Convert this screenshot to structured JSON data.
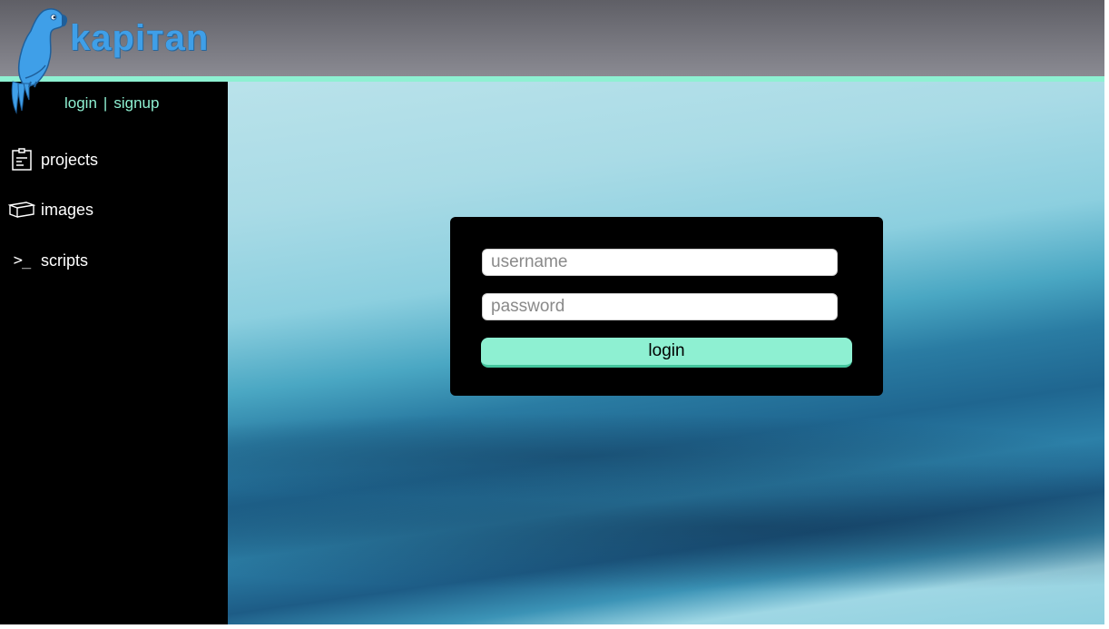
{
  "app": {
    "brand": "kapiтan",
    "logo_icon": "parrot-icon",
    "accent_color": "#8ef0d2",
    "brand_color": "#3f9fe8"
  },
  "sidebar": {
    "auth": {
      "login": "login",
      "separator": "|",
      "signup": "signup"
    },
    "items": [
      {
        "label": "projects",
        "icon": "clipboard-icon"
      },
      {
        "label": "images",
        "icon": "box-icon"
      },
      {
        "label": "scripts",
        "icon": "terminal-icon",
        "glyph": ">_"
      }
    ]
  },
  "login_form": {
    "username_placeholder": "username",
    "password_placeholder": "password",
    "submit_label": "login"
  }
}
